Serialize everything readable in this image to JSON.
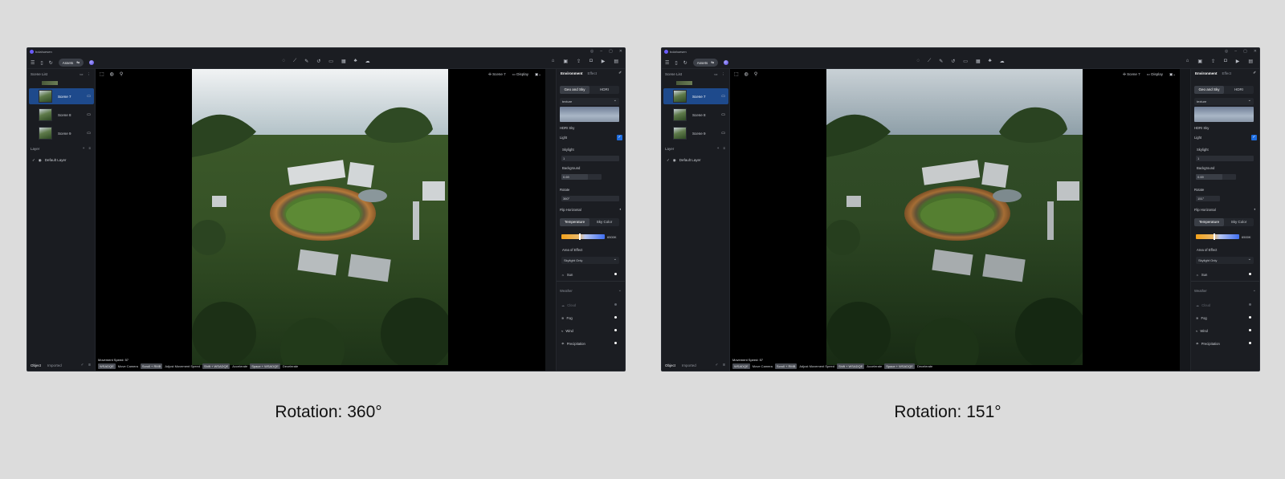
{
  "window": {
    "title": "bolahuesen"
  },
  "toolbar": {
    "assets_label": "Assets"
  },
  "sidebar": {
    "scene_list_label": "Scene List",
    "scenes": [
      {
        "label": "Scene 7",
        "active": true
      },
      {
        "label": "Scene 8",
        "active": false
      },
      {
        "label": "Scene 9",
        "active": false
      }
    ],
    "layer_label": "Layer",
    "default_layer": "Default Layer",
    "tab_object": "Object",
    "tab_imported": "Imported"
  },
  "viewport": {
    "scene_name": "Scene 7",
    "display_label": "Display",
    "movement_speed": "Movement Speed: 57",
    "shortcuts": [
      {
        "key": "WSADQE",
        "action": "Move Camera"
      },
      {
        "key": "Scroll + RMB",
        "action": "Adjust Movement Speed"
      },
      {
        "key": "Shift + WSADQE",
        "action": "Accelerate"
      },
      {
        "key": "Space + WSADQE",
        "action": "Decelerate"
      }
    ]
  },
  "environment": {
    "tab_environment": "Environment",
    "tab_effect": "Effect",
    "seg_geo_sky": "Geo and Sky",
    "seg_hdri": "HDRI",
    "texture_dropdown": "texture",
    "hdri_sky_label": "HDRI Sky",
    "light_label": "Light",
    "skylight_label": "Skylight",
    "skylight_value": "1",
    "background_label": "Background",
    "background_value": "0.69",
    "rotate_label": "Rotate",
    "flip_label": "Flip Horizontal",
    "seg_temperature": "Temperature",
    "seg_sky_color": "Sky Color",
    "kelvin": "6500K",
    "area_label": "Area of Effect",
    "area_value": "Skylight Only",
    "sun_label": "Sun",
    "weather_label": "Weather",
    "cloud_label": "Cloud",
    "fog_label": "Fog",
    "wind_label": "Wind",
    "precip_label": "Precipitation"
  },
  "panels": [
    {
      "rotate_value": "360°",
      "caption": "Rotation: 360°"
    },
    {
      "rotate_value": "151°",
      "caption": "Rotation: 151°"
    }
  ],
  "colors": {
    "accent": "#1e6de0",
    "active_scene": "#1e4a8c",
    "background": "#dcdcdc"
  }
}
